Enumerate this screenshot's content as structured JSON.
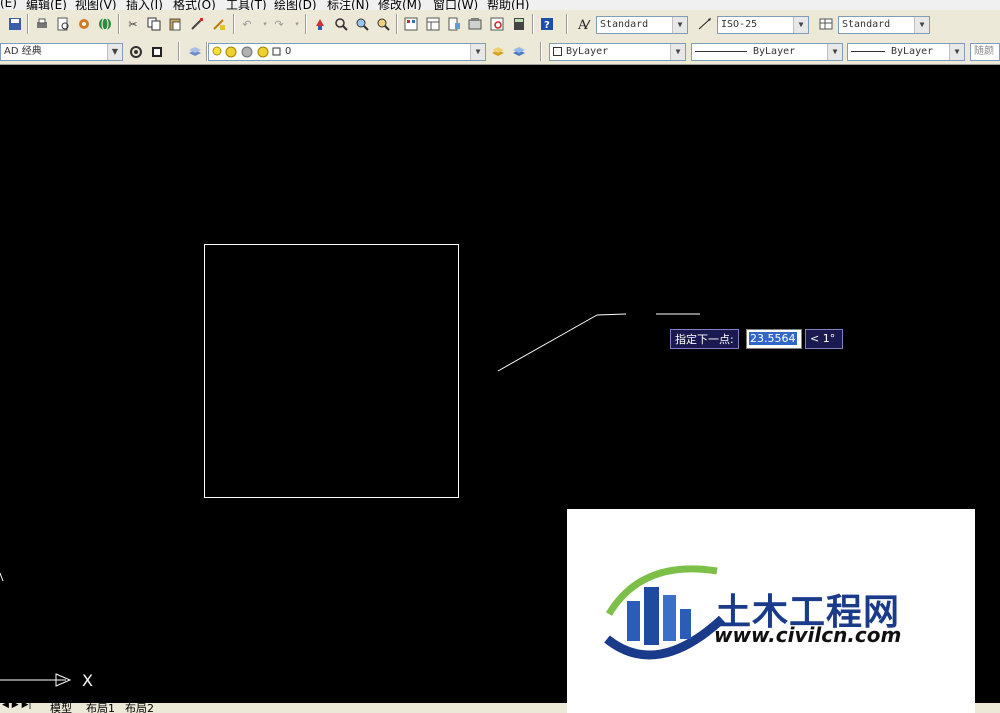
{
  "menu": [
    "(E)",
    "编辑(E)",
    "视图(V)",
    "插入(I)",
    "格式(O)",
    "工具(T)",
    "绘图(D)",
    "标注(N)",
    "修改(M)",
    "窗口(W)",
    "帮助(H)"
  ],
  "toolbar1": {
    "text_style": "Standard",
    "dim_style": "ISO-25",
    "table_style": "Standard"
  },
  "toolbar2": {
    "workspace": "AD 经典",
    "layer": "0",
    "color": "ByLayer",
    "linetype": "ByLayer",
    "lineweight": "ByLayer",
    "plotstyle": "随颜"
  },
  "dynamic_input": {
    "prompt": "指定下一点:",
    "length_value": "23.5564",
    "angle": "< 1°"
  },
  "ucs": {
    "x_label": "X"
  },
  "layout_tabs": [
    "模型",
    "布局1",
    "布局2"
  ],
  "watermark": {
    "brand": "土木工程网",
    "url": "www.civilcn.com"
  },
  "colors": {
    "canvas": "#000000",
    "toolbar": "#ece9d8",
    "brand_blue": "#1a3a8a",
    "brand_green": "#6ab04c"
  }
}
